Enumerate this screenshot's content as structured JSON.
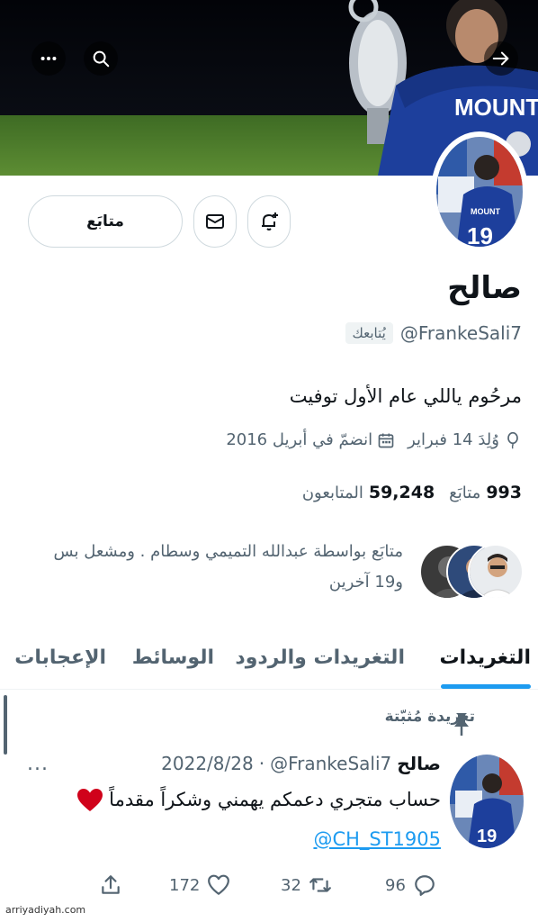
{
  "banner": {
    "jersey_text": "MOUNT"
  },
  "profile": {
    "name": "صالح",
    "handle": "@FrankeSali7",
    "follows_you": "يُتابعك",
    "bio": "مرحُوم ياللي عام الأول توفيت",
    "birthday": "وُلِدَ 14 فبراير",
    "joined": "انضمّ في أبريل 2016",
    "following_count": "993",
    "following_label": "متابَع",
    "followers_count": "59,248",
    "followers_label": "المتابعون",
    "followed_by": "متابَع بواسطة عبدالله التميمي وسطام . ومشعل بس و19 آخرين"
  },
  "actions": {
    "follow_label": "متابَع"
  },
  "tabs": [
    {
      "label": "التغريدات"
    },
    {
      "label": "التغريدات والردود"
    },
    {
      "label": "الوسائط"
    },
    {
      "label": "الإعجابات"
    }
  ],
  "tweet": {
    "pinned_label": "تغريدة مُثبّتة",
    "name": "صالح",
    "handle": "@FrankeSali7",
    "dot": "·",
    "date": "2022/8/28",
    "more": "...",
    "text": "حساب متجري دعمكم يهمني وشكراً مقدماً",
    "link": "@CH_ST1905",
    "replies": "96",
    "retweets": "32",
    "likes": "172"
  },
  "watermark": "arriyadiyah.com",
  "colors": {
    "accent": "#1d9bf0",
    "secondary_text": "#536471",
    "border": "#cfd9de"
  }
}
